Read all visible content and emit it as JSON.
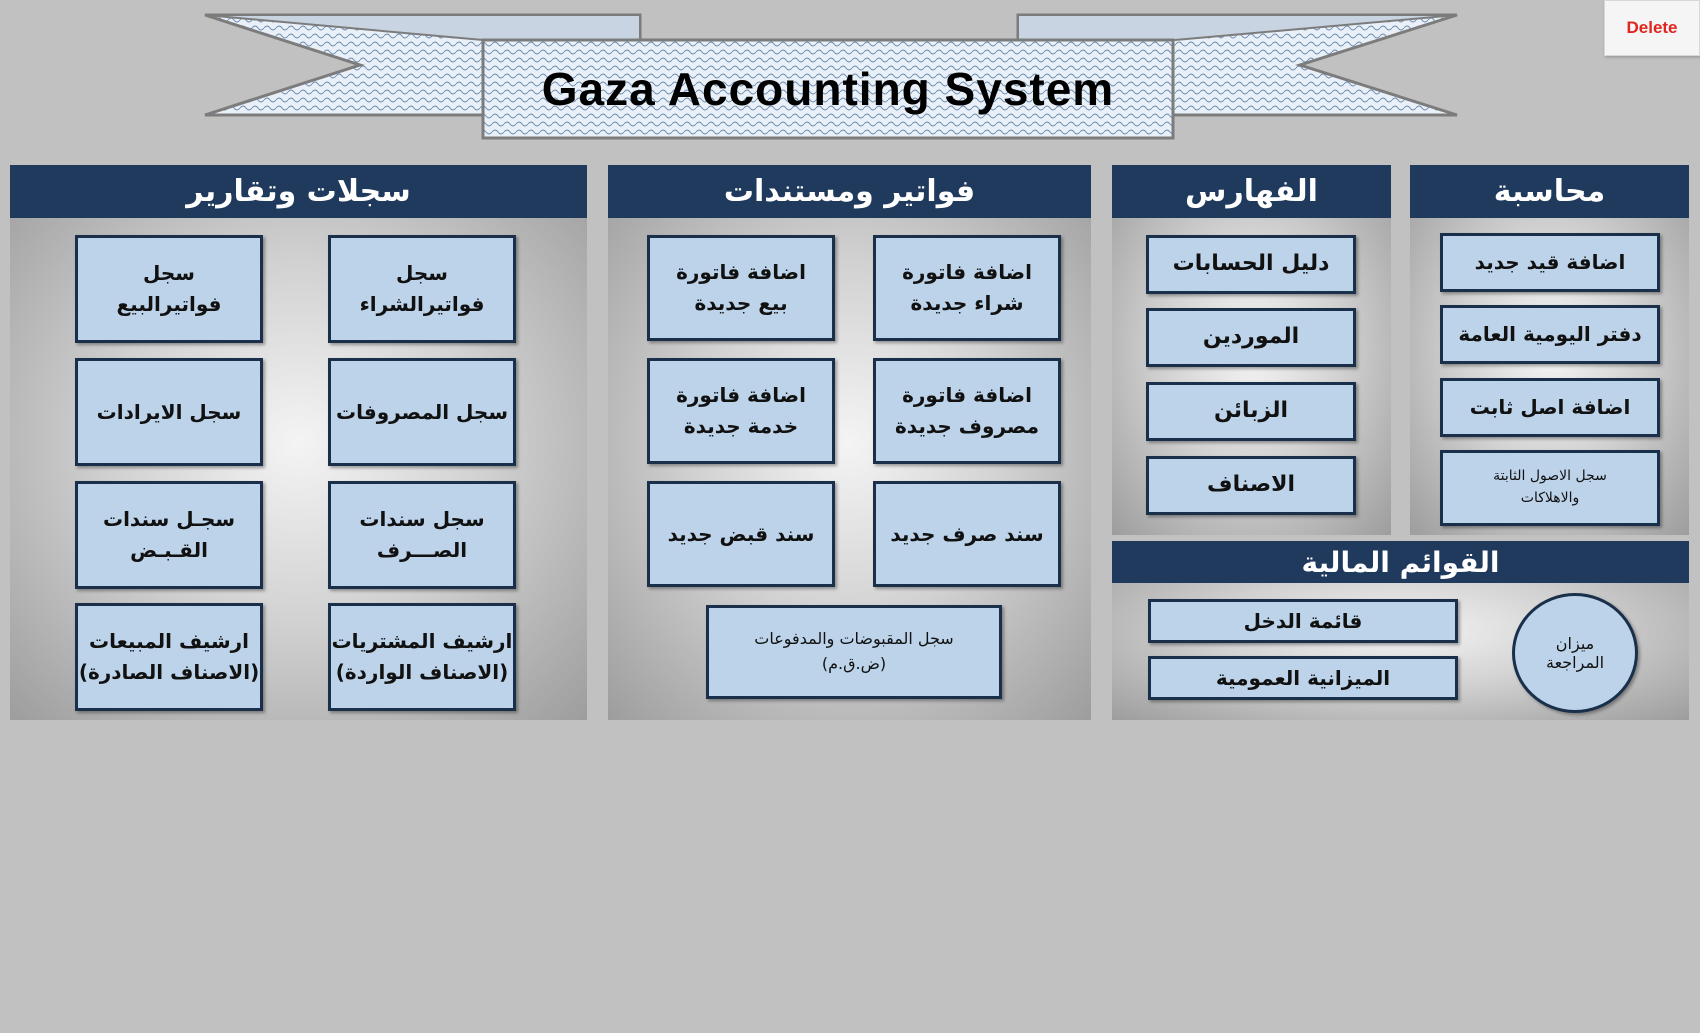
{
  "app": {
    "title": "Gaza Accounting System",
    "delete_label": "Delete"
  },
  "colors": {
    "header_bg": "#1f3a5c",
    "button_bg": "#bcd3ea",
    "button_border": "#1a2f4a",
    "delete_text": "#e0261f",
    "page_bg": "#c1c1c1"
  },
  "sections": {
    "records": {
      "title": "سجلات وتقارير",
      "buttons": [
        {
          "line1": "سجل",
          "line2": "فواتيرالشراء"
        },
        {
          "line1": "سجل",
          "line2": "فواتيرالبيع"
        },
        {
          "line1": "سجل المصروفات"
        },
        {
          "line1": "سجل الايرادات"
        },
        {
          "line1": "سجل سندات",
          "line2": "الصـــرف"
        },
        {
          "line1": "سجـل سندات",
          "line2": "القـبـض"
        },
        {
          "line1": "ارشيف المشتريات",
          "line2": "(الاصناف الواردة)"
        },
        {
          "line1": "ارشيف المبيعات",
          "line2": "(الاصناف الصادرة)"
        }
      ]
    },
    "invoices": {
      "title": "فواتير ومستندات",
      "buttons": [
        {
          "line1": "اضافة فاتورة",
          "line2": "شراء جديدة"
        },
        {
          "line1": "اضافة فاتورة",
          "line2": "بيع جديدة"
        },
        {
          "line1": "اضافة فاتورة",
          "line2": "مصروف جديدة"
        },
        {
          "line1": "اضافة فاتورة",
          "line2": "خدمة جديدة"
        },
        {
          "line1": "سند صرف جديد"
        },
        {
          "line1": "سند قبض جديد"
        },
        {
          "line1": "سجل المقبوضات والمدفوعات",
          "line2": "(ض.ق.م)"
        }
      ]
    },
    "indexes": {
      "title": "الفهارس",
      "buttons": [
        {
          "line1": "دليل الحسابات"
        },
        {
          "line1": "الموردين"
        },
        {
          "line1": "الزبائن"
        },
        {
          "line1": "الاصناف"
        }
      ]
    },
    "accounting": {
      "title": "محاسبة",
      "buttons": [
        {
          "line1": "اضافة قيد جديد"
        },
        {
          "line1": "دفتر اليومية العامة"
        },
        {
          "line1": "اضافة اصل ثابت"
        },
        {
          "line1": "سجل الاصول الثابتة",
          "line2": "والاهلاكات"
        }
      ]
    },
    "financial": {
      "title": "القوائم المالية",
      "buttons": [
        {
          "line1": "قائمة الدخل"
        },
        {
          "line1": "الميزانية العمومية"
        }
      ],
      "circle": {
        "line1": "ميزان",
        "line2": "المراجعة"
      }
    }
  }
}
